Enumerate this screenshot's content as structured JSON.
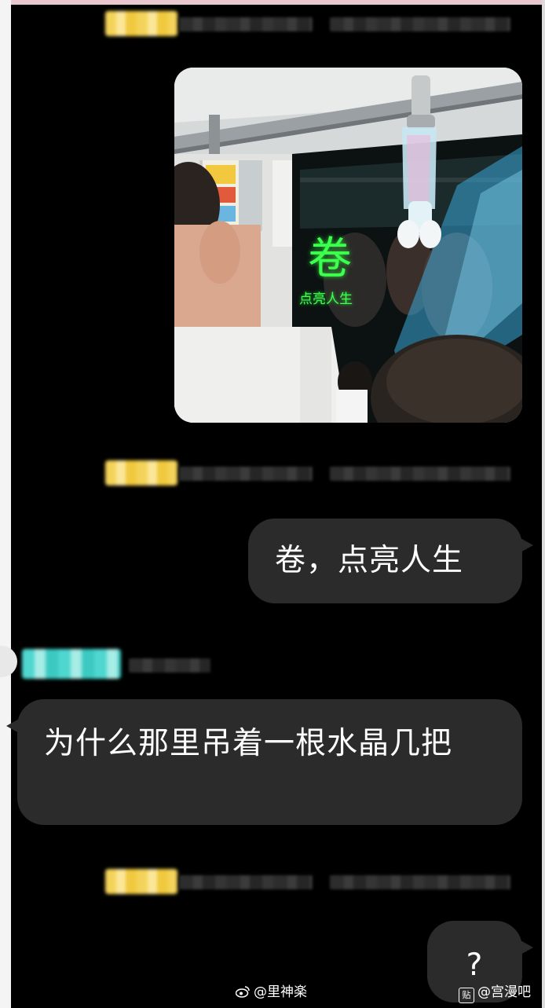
{
  "messages": [
    {
      "id": "m1",
      "type": "image",
      "side": "right",
      "image": {
        "sign_char": "卷",
        "sign_sub": "点亮人生"
      }
    },
    {
      "id": "m2",
      "type": "text",
      "side": "right",
      "text": "卷，点亮人生"
    },
    {
      "id": "m3",
      "type": "text",
      "side": "left",
      "text": "为什么那里吊着一根水晶几把"
    },
    {
      "id": "m4",
      "type": "text",
      "side": "right",
      "text": "?"
    }
  ],
  "watermark": {
    "weibo": "@里神楽",
    "tieba": "@宫漫吧",
    "tieba_badge": "贴"
  },
  "colors": {
    "background": "#000000",
    "bubble": "#2b2b2b",
    "name_tag_self": "#f4d35a",
    "name_tag_other": "#4fd6cf",
    "sign_green": "#3cff4e"
  },
  "icons": {
    "weibo": "weibo-icon",
    "tieba": "tieba-icon"
  }
}
